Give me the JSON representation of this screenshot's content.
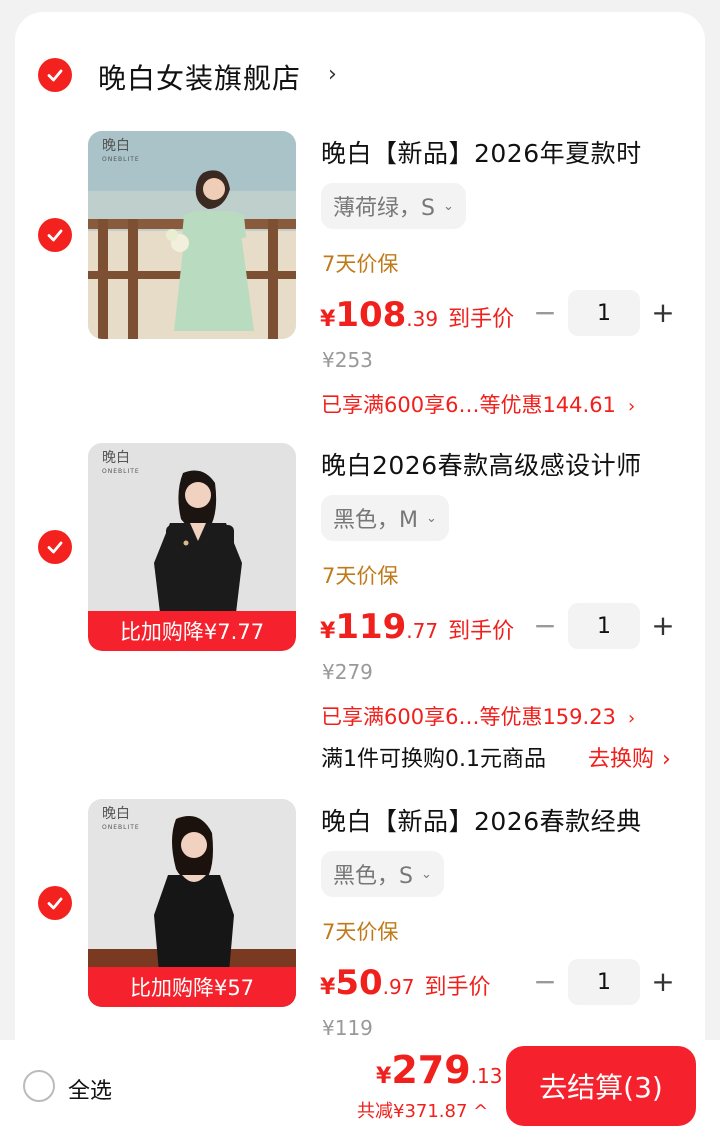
{
  "store": {
    "name": "晚白女装旗舰店",
    "chevron": "›"
  },
  "items": [
    {
      "title": "晚白【新品】2026年夏款时",
      "sku": "薄荷绿，S",
      "guarantee": "7天价保",
      "price_symbol": "¥",
      "price_int": "108",
      "price_dec": ".39",
      "price_label": "到手价",
      "quantity": "1",
      "original_price": "¥253",
      "discount": "已享满600享6…等优惠144.61",
      "watermark": "晚白",
      "watermark_sub": "ONEBLITE",
      "promo": ""
    },
    {
      "title": "晚白2026春款高级感设计师",
      "sku": "黑色，M",
      "guarantee": "7天价保",
      "price_symbol": "¥",
      "price_int": "119",
      "price_dec": ".77",
      "price_label": "到手价",
      "quantity": "1",
      "original_price": "¥279",
      "discount": "已享满600享6…等优惠159.23",
      "promo": "比加购降¥7.77",
      "swap_text": "满1件可换购0.1元商品",
      "swap_link": "去换购",
      "watermark": "晚白",
      "watermark_sub": "ONEBLITE"
    },
    {
      "title": "晚白【新品】2026春款经典",
      "sku": "黑色，S",
      "guarantee": "7天价保",
      "price_symbol": "¥",
      "price_int": "50",
      "price_dec": ".97",
      "price_label": "到手价",
      "quantity": "1",
      "original_price": "¥119",
      "promo": "比加购降¥57",
      "watermark": "晚白",
      "watermark_sub": "ONEBLITE"
    }
  ],
  "footer": {
    "select_all": "全选",
    "total_symbol": "¥",
    "total_int": "279",
    "total_dec": ".13",
    "saved": "共减¥371.87 ^",
    "checkout": "去结算(3)"
  },
  "colors": {
    "accent": "#f5222d",
    "guarantee": "#c07a1a",
    "mint_dress": "#b9dcc0",
    "black_dress": "#1b1b1b"
  },
  "icons": {
    "check": "check-icon",
    "minus": "minus-icon",
    "plus": "plus-icon",
    "dropdown": "chevron-down-icon",
    "chevron_right": "chevron-right-icon"
  }
}
